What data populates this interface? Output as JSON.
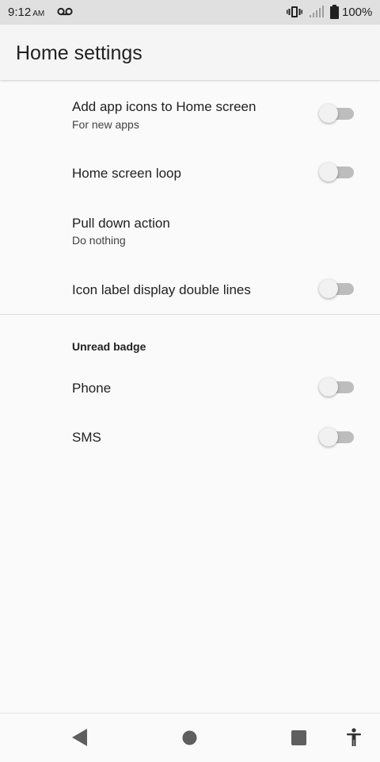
{
  "status_bar": {
    "time": "9:12",
    "ampm": "AM",
    "battery": "100%"
  },
  "app_bar": {
    "title": "Home settings"
  },
  "preferences": [
    {
      "title": "Add app icons to Home screen",
      "summary": "For new apps",
      "switch_on": false
    },
    {
      "title": "Home screen loop",
      "switch_on": false
    },
    {
      "title": "Pull down action",
      "summary": "Do nothing"
    },
    {
      "title": "Icon label display double lines",
      "switch_on": false
    }
  ],
  "unread_badge": {
    "header": "Unread badge",
    "items": [
      {
        "title": "Phone",
        "switch_on": false
      },
      {
        "title": "SMS",
        "switch_on": false
      }
    ]
  },
  "icons": {
    "voicemail": "voicemail-icon",
    "vibrate": "vibrate-icon",
    "signal": "signal-icon",
    "battery": "battery-icon",
    "back": "back-icon",
    "home": "home-icon",
    "recents": "recents-icon",
    "accessibility": "accessibility-icon"
  },
  "colors": {
    "status_bar": "#e0e0e0",
    "switch_track_off": "#bdbdbd",
    "switch_thumb_off": "#f1f1f1"
  }
}
